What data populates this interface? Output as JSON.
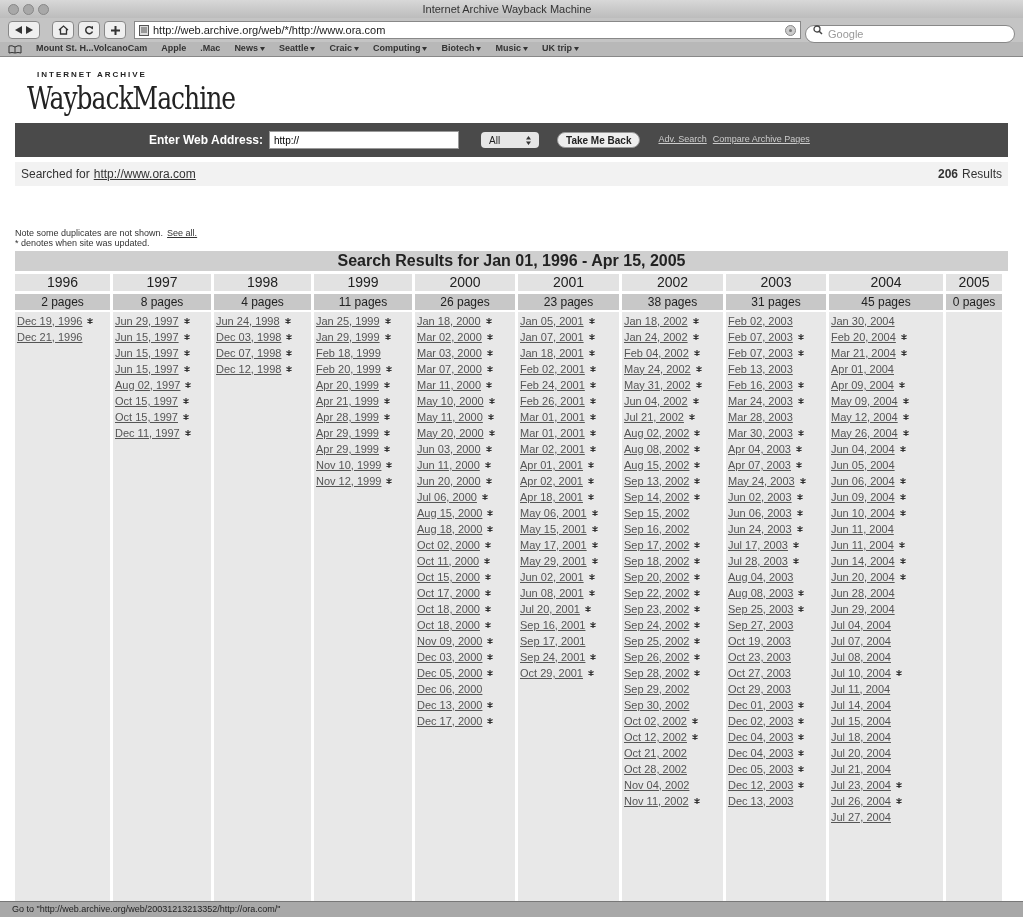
{
  "window": {
    "title": "Internet Archive Wayback Machine"
  },
  "toolbar": {
    "address": "http://web.archive.org/web/*/http://www.ora.com",
    "search_placeholder": "Google"
  },
  "bookmarks": [
    {
      "label": "Mount St. H...VolcanoCam",
      "menu": false
    },
    {
      "label": "Apple",
      "menu": false
    },
    {
      "label": ".Mac",
      "menu": false
    },
    {
      "label": "News",
      "menu": true
    },
    {
      "label": "Seattle",
      "menu": true
    },
    {
      "label": "Craic",
      "menu": true
    },
    {
      "label": "Computing",
      "menu": true
    },
    {
      "label": "Biotech",
      "menu": true
    },
    {
      "label": "Music",
      "menu": true
    },
    {
      "label": "UK trip",
      "menu": true
    }
  ],
  "logo": {
    "top": "INTERNET ARCHIVE",
    "main": "WaybackMachine"
  },
  "search_bar": {
    "label": "Enter Web Address:",
    "value": "http://",
    "select": "All",
    "button": "Take Me Back",
    "links": [
      "Adv. Search",
      "Compare Archive Pages"
    ]
  },
  "searched": {
    "prefix": "Searched for",
    "url": "http://www.ora.com",
    "count": "206",
    "count_label": "Results"
  },
  "note": {
    "text": "Note some duplicates are not shown.",
    "link": "See all.",
    "legend": "* denotes when site was updated."
  },
  "results": {
    "title": "Search Results for Jan 01, 1996 - Apr 15, 2005",
    "years": [
      {
        "year": "1996",
        "pages": "2 pages",
        "entries": [
          {
            "date": "Dec 19, 1996",
            "updated": true
          },
          {
            "date": "Dec 21, 1996",
            "updated": false
          }
        ]
      },
      {
        "year": "1997",
        "pages": "8 pages",
        "entries": [
          {
            "date": "Jun 29, 1997",
            "updated": true
          },
          {
            "date": "Jun 15, 1997",
            "updated": true
          },
          {
            "date": "Jun 15, 1997",
            "updated": true
          },
          {
            "date": "Jun 15, 1997",
            "updated": true
          },
          {
            "date": "Aug 02, 1997",
            "updated": true
          },
          {
            "date": "Oct 15, 1997",
            "updated": true
          },
          {
            "date": "Oct 15, 1997",
            "updated": true
          },
          {
            "date": "Dec 11, 1997",
            "updated": true
          }
        ]
      },
      {
        "year": "1998",
        "pages": "4 pages",
        "entries": [
          {
            "date": "Jun 24, 1998",
            "updated": true
          },
          {
            "date": "Dec 03, 1998",
            "updated": true
          },
          {
            "date": "Dec 07, 1998",
            "updated": true
          },
          {
            "date": "Dec 12, 1998",
            "updated": true
          }
        ]
      },
      {
        "year": "1999",
        "pages": "11 pages",
        "entries": [
          {
            "date": "Jan 25, 1999",
            "updated": true
          },
          {
            "date": "Jan 29, 1999",
            "updated": true
          },
          {
            "date": "Feb 18, 1999",
            "updated": false
          },
          {
            "date": "Feb 20, 1999",
            "updated": true
          },
          {
            "date": "Apr 20, 1999",
            "updated": true
          },
          {
            "date": "Apr 21, 1999",
            "updated": true
          },
          {
            "date": "Apr 28, 1999",
            "updated": true
          },
          {
            "date": "Apr 29, 1999",
            "updated": true
          },
          {
            "date": "Apr 29, 1999",
            "updated": true
          },
          {
            "date": "Nov 10, 1999",
            "updated": true
          },
          {
            "date": "Nov 12, 1999",
            "updated": true
          }
        ]
      },
      {
        "year": "2000",
        "pages": "26 pages",
        "entries": [
          {
            "date": "Jan 18, 2000",
            "updated": true
          },
          {
            "date": "Mar 02, 2000",
            "updated": true
          },
          {
            "date": "Mar 03, 2000",
            "updated": true
          },
          {
            "date": "Mar 07, 2000",
            "updated": true
          },
          {
            "date": "Mar 11, 2000",
            "updated": true
          },
          {
            "date": "May 10, 2000",
            "updated": true
          },
          {
            "date": "May 11, 2000",
            "updated": true
          },
          {
            "date": "May 20, 2000",
            "updated": true
          },
          {
            "date": "Jun 03, 2000",
            "updated": true
          },
          {
            "date": "Jun 11, 2000",
            "updated": true
          },
          {
            "date": "Jun 20, 2000",
            "updated": true
          },
          {
            "date": "Jul 06, 2000",
            "updated": true
          },
          {
            "date": "Aug 15, 2000",
            "updated": true
          },
          {
            "date": "Aug 18, 2000",
            "updated": true
          },
          {
            "date": "Oct 02, 2000",
            "updated": true
          },
          {
            "date": "Oct 11, 2000",
            "updated": true
          },
          {
            "date": "Oct 15, 2000",
            "updated": true
          },
          {
            "date": "Oct 17, 2000",
            "updated": true
          },
          {
            "date": "Oct 18, 2000",
            "updated": true
          },
          {
            "date": "Oct 18, 2000",
            "updated": true
          },
          {
            "date": "Nov 09, 2000",
            "updated": true
          },
          {
            "date": "Dec 03, 2000",
            "updated": true
          },
          {
            "date": "Dec 05, 2000",
            "updated": true
          },
          {
            "date": "Dec 06, 2000",
            "updated": false
          },
          {
            "date": "Dec 13, 2000",
            "updated": true
          },
          {
            "date": "Dec 17, 2000",
            "updated": true
          }
        ]
      },
      {
        "year": "2001",
        "pages": "23 pages",
        "entries": [
          {
            "date": "Jan 05, 2001",
            "updated": true
          },
          {
            "date": "Jan 07, 2001",
            "updated": true
          },
          {
            "date": "Jan 18, 2001",
            "updated": true
          },
          {
            "date": "Feb 02, 2001",
            "updated": true
          },
          {
            "date": "Feb 24, 2001",
            "updated": true
          },
          {
            "date": "Feb 26, 2001",
            "updated": true
          },
          {
            "date": "Mar 01, 2001",
            "updated": true
          },
          {
            "date": "Mar 01, 2001",
            "updated": true
          },
          {
            "date": "Mar 02, 2001",
            "updated": true
          },
          {
            "date": "Apr 01, 2001",
            "updated": true
          },
          {
            "date": "Apr 02, 2001",
            "updated": true
          },
          {
            "date": "Apr 18, 2001",
            "updated": true
          },
          {
            "date": "May 06, 2001",
            "updated": true
          },
          {
            "date": "May 15, 2001",
            "updated": true
          },
          {
            "date": "May 17, 2001",
            "updated": true
          },
          {
            "date": "May 29, 2001",
            "updated": true
          },
          {
            "date": "Jun 02, 2001",
            "updated": true
          },
          {
            "date": "Jun 08, 2001",
            "updated": true
          },
          {
            "date": "Jul 20, 2001",
            "updated": true
          },
          {
            "date": "Sep 16, 2001",
            "updated": true
          },
          {
            "date": "Sep 17, 2001",
            "updated": false
          },
          {
            "date": "Sep 24, 2001",
            "updated": true
          },
          {
            "date": "Oct 29, 2001",
            "updated": true
          }
        ]
      },
      {
        "year": "2002",
        "pages": "38 pages",
        "entries": [
          {
            "date": "Jan 18, 2002",
            "updated": true
          },
          {
            "date": "Jan 24, 2002",
            "updated": true
          },
          {
            "date": "Feb 04, 2002",
            "updated": true
          },
          {
            "date": "May 24, 2002",
            "updated": true
          },
          {
            "date": "May 31, 2002",
            "updated": true
          },
          {
            "date": "Jun 04, 2002",
            "updated": true
          },
          {
            "date": "Jul 21, 2002",
            "updated": true
          },
          {
            "date": "Aug 02, 2002",
            "updated": true
          },
          {
            "date": "Aug 08, 2002",
            "updated": true
          },
          {
            "date": "Aug 15, 2002",
            "updated": true
          },
          {
            "date": "Sep 13, 2002",
            "updated": true
          },
          {
            "date": "Sep 14, 2002",
            "updated": true
          },
          {
            "date": "Sep 15, 2002",
            "updated": false
          },
          {
            "date": "Sep 16, 2002",
            "updated": false
          },
          {
            "date": "Sep 17, 2002",
            "updated": true
          },
          {
            "date": "Sep 18, 2002",
            "updated": true
          },
          {
            "date": "Sep 20, 2002",
            "updated": true
          },
          {
            "date": "Sep 22, 2002",
            "updated": true
          },
          {
            "date": "Sep 23, 2002",
            "updated": true
          },
          {
            "date": "Sep 24, 2002",
            "updated": true
          },
          {
            "date": "Sep 25, 2002",
            "updated": true
          },
          {
            "date": "Sep 26, 2002",
            "updated": true
          },
          {
            "date": "Sep 28, 2002",
            "updated": true
          },
          {
            "date": "Sep 29, 2002",
            "updated": false
          },
          {
            "date": "Sep 30, 2002",
            "updated": false
          },
          {
            "date": "Oct 02, 2002",
            "updated": true
          },
          {
            "date": "Oct 12, 2002",
            "updated": true
          },
          {
            "date": "Oct 21, 2002",
            "updated": false
          },
          {
            "date": "Oct 28, 2002",
            "updated": false
          },
          {
            "date": "Nov 04, 2002",
            "updated": false
          },
          {
            "date": "Nov 11, 2002",
            "updated": true
          }
        ]
      },
      {
        "year": "2003",
        "pages": "31 pages",
        "entries": [
          {
            "date": "Feb 02, 2003",
            "updated": false
          },
          {
            "date": "Feb 07, 2003",
            "updated": true
          },
          {
            "date": "Feb 07, 2003",
            "updated": true
          },
          {
            "date": "Feb 13, 2003",
            "updated": false
          },
          {
            "date": "Feb 16, 2003",
            "updated": true
          },
          {
            "date": "Mar 24, 2003",
            "updated": true
          },
          {
            "date": "Mar 28, 2003",
            "updated": false
          },
          {
            "date": "Mar 30, 2003",
            "updated": true
          },
          {
            "date": "Apr 04, 2003",
            "updated": true
          },
          {
            "date": "Apr 07, 2003",
            "updated": true
          },
          {
            "date": "May 24, 2003",
            "updated": true
          },
          {
            "date": "Jun 02, 2003",
            "updated": true
          },
          {
            "date": "Jun 06, 2003",
            "updated": true
          },
          {
            "date": "Jun 24, 2003",
            "updated": true
          },
          {
            "date": "Jul 17, 2003",
            "updated": true
          },
          {
            "date": "Jul 28, 2003",
            "updated": true
          },
          {
            "date": "Aug 04, 2003",
            "updated": false
          },
          {
            "date": "Aug 08, 2003",
            "updated": true
          },
          {
            "date": "Sep 25, 2003",
            "updated": true
          },
          {
            "date": "Sep 27, 2003",
            "updated": false
          },
          {
            "date": "Oct 19, 2003",
            "updated": false
          },
          {
            "date": "Oct 23, 2003",
            "updated": false
          },
          {
            "date": "Oct 27, 2003",
            "updated": false
          },
          {
            "date": "Oct 29, 2003",
            "updated": false
          },
          {
            "date": "Dec 01, 2003",
            "updated": true
          },
          {
            "date": "Dec 02, 2003",
            "updated": true
          },
          {
            "date": "Dec 04, 2003",
            "updated": true
          },
          {
            "date": "Dec 04, 2003",
            "updated": true
          },
          {
            "date": "Dec 05, 2003",
            "updated": true
          },
          {
            "date": "Dec 12, 2003",
            "updated": true
          },
          {
            "date": "Dec 13, 2003",
            "updated": false
          }
        ]
      },
      {
        "year": "2004",
        "pages": "45 pages",
        "entries": [
          {
            "date": "Jan 30, 2004",
            "updated": false
          },
          {
            "date": "Feb 20, 2004",
            "updated": true
          },
          {
            "date": "Mar 21, 2004",
            "updated": true
          },
          {
            "date": "Apr 01, 2004",
            "updated": false
          },
          {
            "date": "Apr 09, 2004",
            "updated": true
          },
          {
            "date": "May 09, 2004",
            "updated": true
          },
          {
            "date": "May 12, 2004",
            "updated": true
          },
          {
            "date": "May 26, 2004",
            "updated": true
          },
          {
            "date": "Jun 04, 2004",
            "updated": true
          },
          {
            "date": "Jun 05, 2004",
            "updated": false
          },
          {
            "date": "Jun 06, 2004",
            "updated": true
          },
          {
            "date": "Jun 09, 2004",
            "updated": true
          },
          {
            "date": "Jun 10, 2004",
            "updated": true
          },
          {
            "date": "Jun 11, 2004",
            "updated": false
          },
          {
            "date": "Jun 11, 2004",
            "updated": true
          },
          {
            "date": "Jun 14, 2004",
            "updated": true
          },
          {
            "date": "Jun 20, 2004",
            "updated": true
          },
          {
            "date": "Jun 28, 2004",
            "updated": false
          },
          {
            "date": "Jun 29, 2004",
            "updated": false
          },
          {
            "date": "Jul 04, 2004",
            "updated": false
          },
          {
            "date": "Jul 07, 2004",
            "updated": false
          },
          {
            "date": "Jul 08, 2004",
            "updated": false
          },
          {
            "date": "Jul 10, 2004",
            "updated": true
          },
          {
            "date": "Jul 11, 2004",
            "updated": false
          },
          {
            "date": "Jul 14, 2004",
            "updated": false
          },
          {
            "date": "Jul 15, 2004",
            "updated": false
          },
          {
            "date": "Jul 18, 2004",
            "updated": false
          },
          {
            "date": "Jul 20, 2004",
            "updated": false
          },
          {
            "date": "Jul 21, 2004",
            "updated": false
          },
          {
            "date": "Jul 23, 2004",
            "updated": true
          },
          {
            "date": "Jul 26, 2004",
            "updated": true
          },
          {
            "date": "Jul 27, 2004",
            "updated": false
          }
        ]
      },
      {
        "year": "2005",
        "pages": "0 pages"
      }
    ]
  },
  "status_bar": "Go to \"http://web.archive.org/web/20031213213352/http://ora.com/\""
}
